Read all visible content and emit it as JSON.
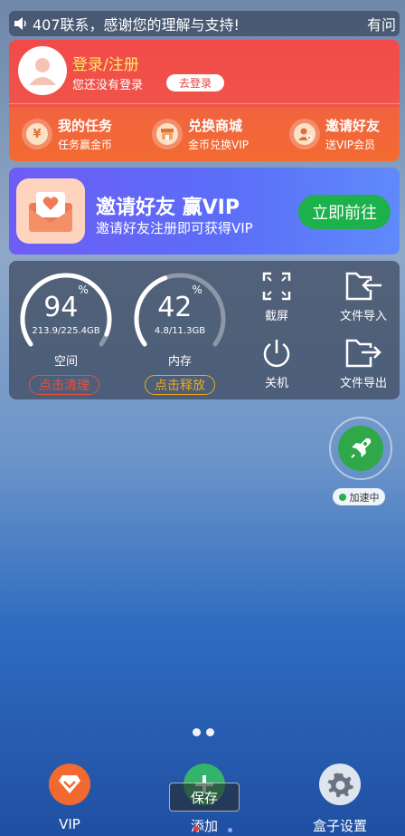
{
  "marquee": {
    "text": "407联系，感谢您的理解与支持!",
    "text_right": "有问"
  },
  "login": {
    "title": "登录/注册",
    "subtitle": "您还没有登录",
    "button": "去登录"
  },
  "features": [
    {
      "title": "我的任务",
      "subtitle": "任务赢金币",
      "icon": "yen-coin-icon"
    },
    {
      "title": "兑换商城",
      "subtitle": "金币兑换VIP",
      "icon": "shop-icon"
    },
    {
      "title": "邀请好友",
      "subtitle": "送VIP会员",
      "icon": "add-user-icon"
    }
  ],
  "invite": {
    "title": "邀请好友 赢VIP",
    "subtitle": "邀请好友注册即可获得VIP",
    "button": "立即前往"
  },
  "storage": {
    "percent": "94",
    "percent_value": 94,
    "unit": "%",
    "detail": "213.9/225.4GB",
    "label": "空间",
    "button": "点击清理",
    "button_color": "#e8503f"
  },
  "memory": {
    "percent": "42",
    "percent_value": 42,
    "unit": "%",
    "detail": "4.8/11.3GB",
    "label": "内存",
    "button": "点击释放",
    "button_color": "#f0a818"
  },
  "tools": {
    "screenshot": "截屏",
    "file_import": "文件导入",
    "shutdown": "关机",
    "file_export": "文件导出"
  },
  "accelerator": {
    "label": "加速中"
  },
  "dock": {
    "vip": "VIP",
    "add": "添加",
    "settings": "盒子设置",
    "save_toast": "保存"
  },
  "colors": {
    "accent_green": "#1cb14a",
    "login_red": "#f24a4a",
    "vip_orange": "#f26a32"
  }
}
